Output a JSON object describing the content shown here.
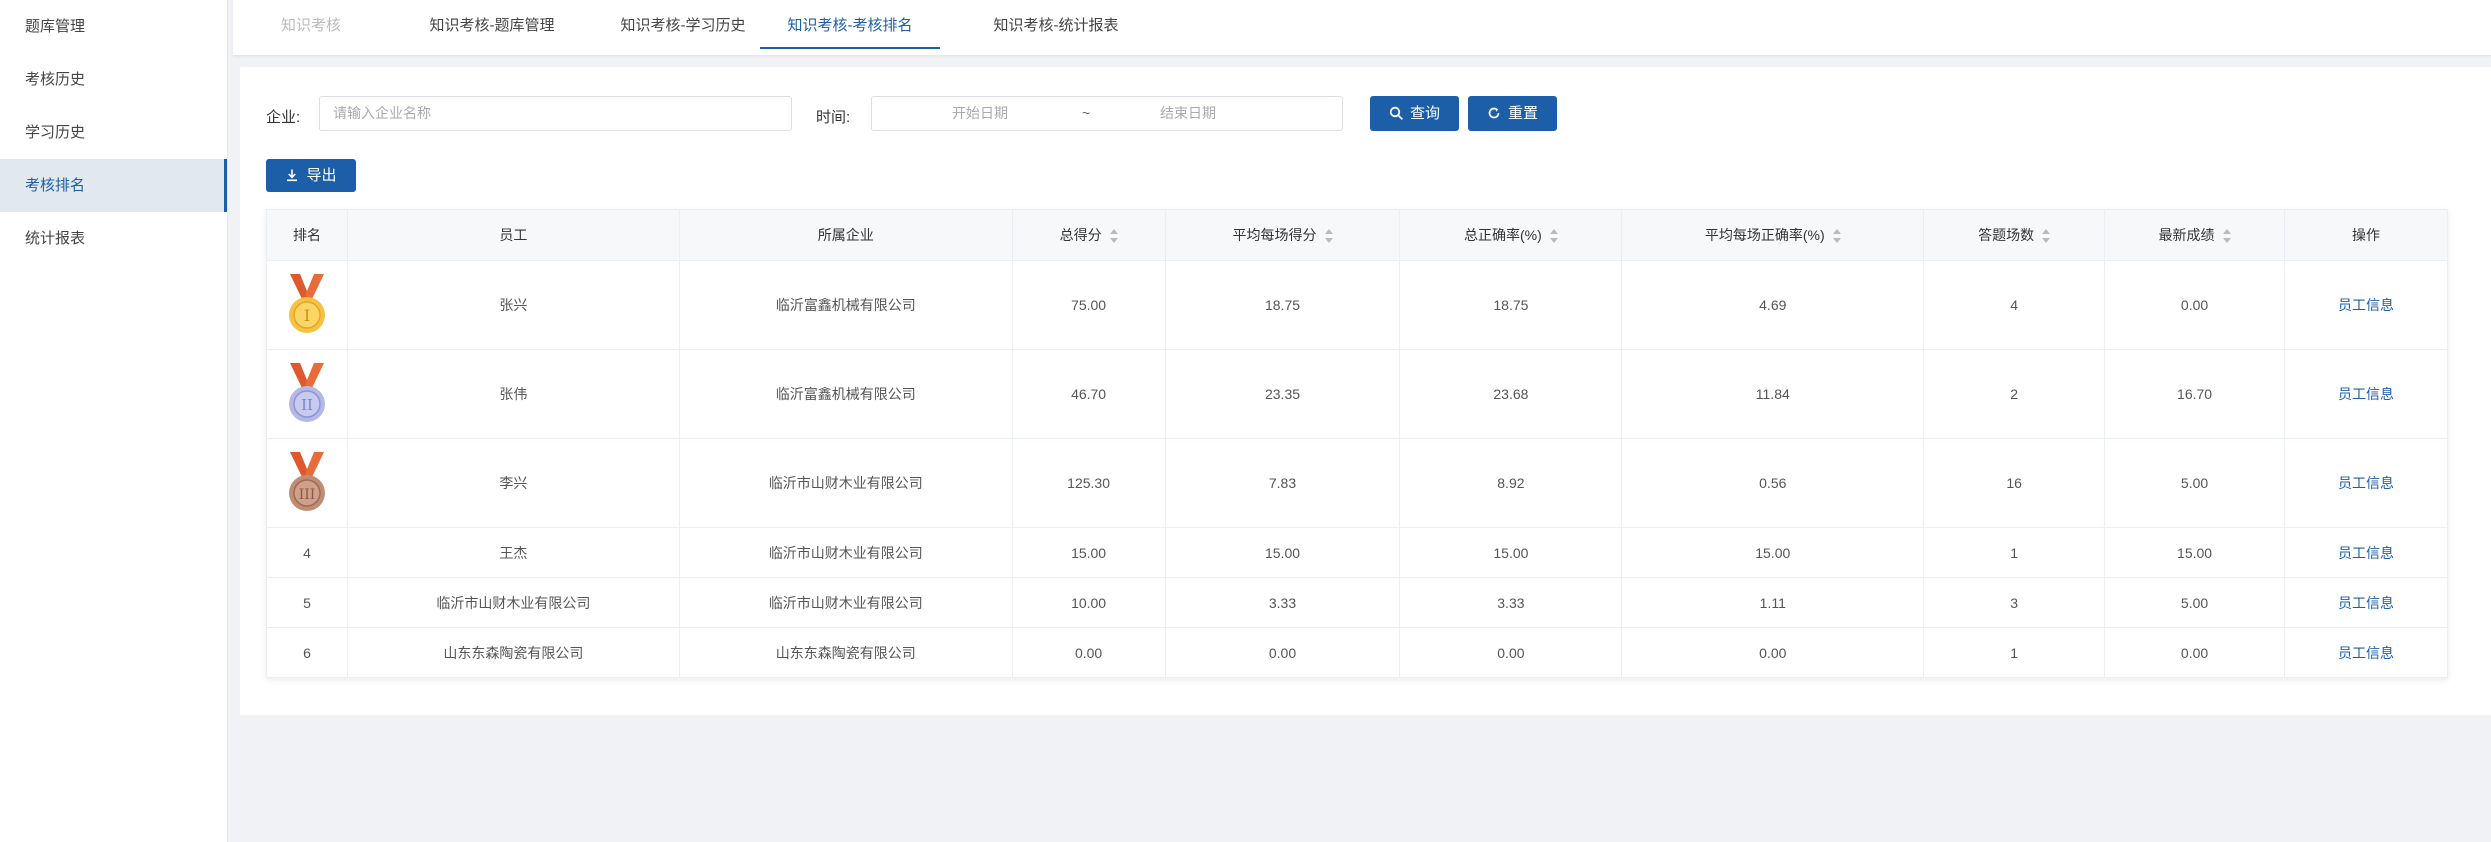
{
  "sidebar": {
    "items": [
      {
        "label": "题库管理"
      },
      {
        "label": "考核历史"
      },
      {
        "label": "学习历史"
      },
      {
        "label": "考核排名"
      },
      {
        "label": "统计报表"
      }
    ]
  },
  "tabs": [
    {
      "label": "知识考核"
    },
    {
      "label": "知识考核-题库管理"
    },
    {
      "label": "知识考核-学习历史"
    },
    {
      "label": "知识考核-考核排名"
    },
    {
      "label": "知识考核-统计报表"
    }
  ],
  "filters": {
    "company_label": "企业:",
    "company_placeholder": "请输入企业名称",
    "time_label": "时间:",
    "start_placeholder": "开始日期",
    "range_sep": "~",
    "end_placeholder": "结束日期",
    "query_label": "查询",
    "reset_label": "重置"
  },
  "export_label": "导出",
  "table": {
    "headers": [
      "排名",
      "员工",
      "所属企业",
      "总得分",
      "平均每场得分",
      "总正确率(%)",
      "平均每场正确率(%)",
      "答题场数",
      "最新成绩",
      "操作"
    ],
    "rows": [
      {
        "rank": "1",
        "medal": "gold-medal-icon",
        "employee": "张兴",
        "company": "临沂富鑫机械有限公司",
        "total": "75.00",
        "avg": "18.75",
        "acc": "18.75",
        "avg_acc": "4.69",
        "count": "4",
        "latest": "0.00",
        "action": "员工信息"
      },
      {
        "rank": "2",
        "medal": "silver-medal-icon",
        "employee": "张伟",
        "company": "临沂富鑫机械有限公司",
        "total": "46.70",
        "avg": "23.35",
        "acc": "23.68",
        "avg_acc": "11.84",
        "count": "2",
        "latest": "16.70",
        "action": "员工信息"
      },
      {
        "rank": "3",
        "medal": "bronze-medal-icon",
        "employee": "李兴",
        "company": "临沂市山财木业有限公司",
        "total": "125.30",
        "avg": "7.83",
        "acc": "8.92",
        "avg_acc": "0.56",
        "count": "16",
        "latest": "5.00",
        "action": "员工信息"
      },
      {
        "rank": "4",
        "employee": "王杰",
        "company": "临沂市山财木业有限公司",
        "total": "15.00",
        "avg": "15.00",
        "acc": "15.00",
        "avg_acc": "15.00",
        "count": "1",
        "latest": "15.00",
        "action": "员工信息"
      },
      {
        "rank": "5",
        "employee": "临沂市山财木业有限公司",
        "company": "临沂市山财木业有限公司",
        "total": "10.00",
        "avg": "3.33",
        "acc": "3.33",
        "avg_acc": "1.11",
        "count": "3",
        "latest": "5.00",
        "action": "员工信息"
      },
      {
        "rank": "6",
        "employee": "山东东森陶瓷有限公司",
        "company": "山东东森陶瓷有限公司",
        "total": "0.00",
        "avg": "0.00",
        "acc": "0.00",
        "avg_acc": "0.00",
        "count": "1",
        "latest": "0.00",
        "action": "员工信息"
      }
    ]
  },
  "colors": {
    "primary": "#1c5fa8",
    "gold": "#f5c242",
    "silver": "#b3b8e6",
    "bronze": "#c08c74",
    "ribbon": "#e0582b"
  }
}
